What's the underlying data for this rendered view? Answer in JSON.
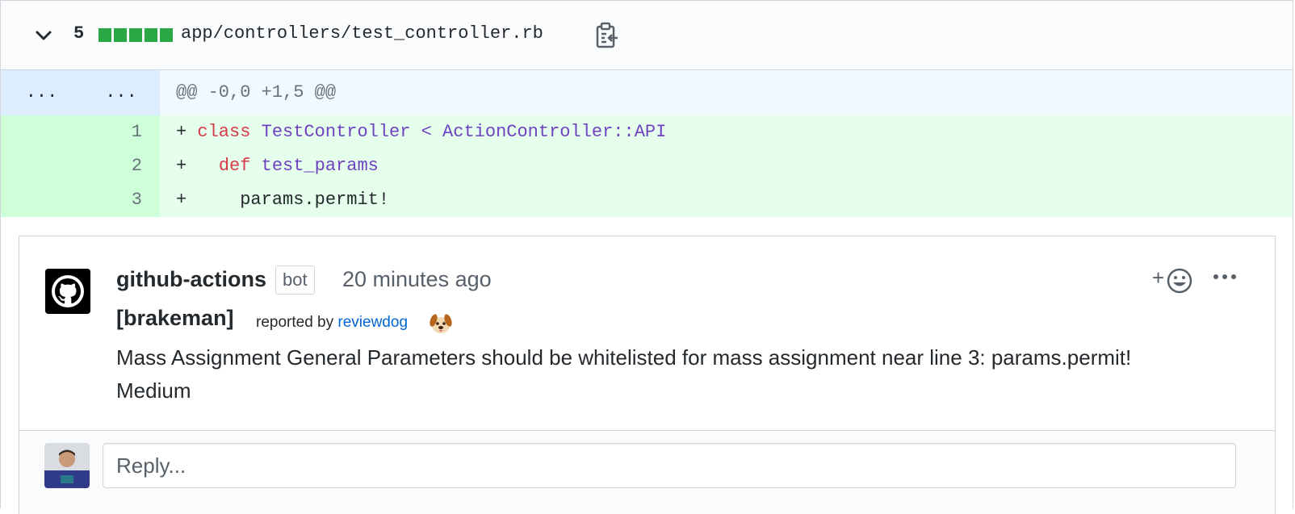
{
  "file": {
    "changes": "5",
    "path": "app/controllers/test_controller.rb",
    "diffstat_color": "#28a745"
  },
  "diff": {
    "hunk": {
      "left": "...",
      "right": "...",
      "text": "@@ -0,0 +1,5 @@"
    },
    "lines": [
      {
        "num": "1",
        "plus": "+ ",
        "kw": "class",
        "rest_pre": " ",
        "ent": "TestController < ActionController::API",
        "tail": ""
      },
      {
        "num": "2",
        "plus": "+   ",
        "kw": "def",
        "rest_pre": " ",
        "ent": "test_params",
        "tail": ""
      },
      {
        "num": "3",
        "plus": "+     ",
        "kw": "",
        "rest_pre": "",
        "ent": "",
        "tail": "params.permit!"
      }
    ]
  },
  "comment": {
    "author": "github-actions",
    "badge": "bot",
    "time": "20 minutes ago",
    "react_plus": "+",
    "tag": "[brakeman]",
    "reported_by": "reported by",
    "reporter": "reviewdog",
    "message_line1": "Mass Assignment General Parameters should be whitelisted for mass assignment near line 3: params.permit!",
    "message_line2": "Medium"
  },
  "reply": {
    "placeholder": "Reply..."
  }
}
